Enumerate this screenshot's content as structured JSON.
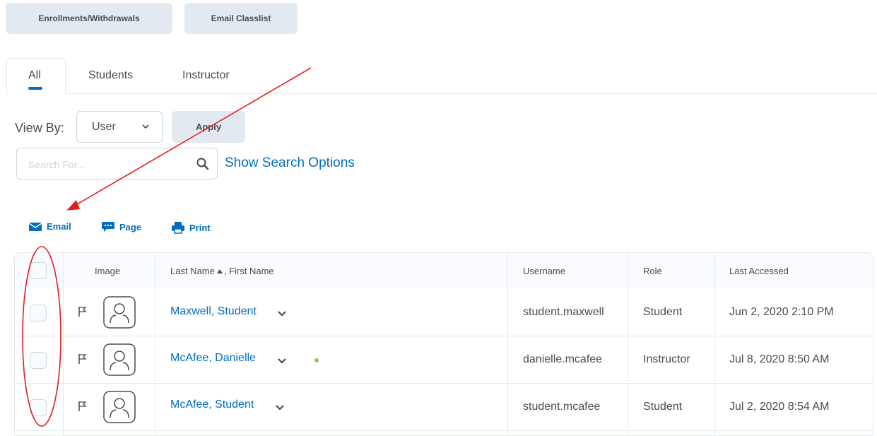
{
  "toolbar": {
    "enrollments_label": "Enrollments/Withdrawals",
    "email_classlist_label": "Email Classlist"
  },
  "tabs": [
    {
      "label": "All",
      "selected": true
    },
    {
      "label": "Students",
      "selected": false
    },
    {
      "label": "Instructor",
      "selected": false
    }
  ],
  "filter": {
    "view_by_label": "View By:",
    "view_by_value": "User",
    "apply_label": "Apply",
    "search_placeholder": "Search For...",
    "show_search_options": "Show Search Options"
  },
  "actions": {
    "email": "Email",
    "page": "Page",
    "print": "Print"
  },
  "table": {
    "headers": {
      "image": "Image",
      "last_name": "Last Name",
      "first_name": ", First Name",
      "username": "Username",
      "role": "Role",
      "last_accessed": "Last Accessed"
    },
    "rows": [
      {
        "name": "Maxwell, Student",
        "username": "student.maxwell",
        "role": "Student",
        "last_accessed": "Jun 2, 2020 2:10 PM",
        "online": false
      },
      {
        "name": "McAfee, Danielle",
        "username": "danielle.mcafee",
        "role": "Instructor",
        "last_accessed": "Jul 8, 2020 8:50 AM",
        "online": true
      },
      {
        "name": "McAfee, Student",
        "username": "student.mcafee",
        "role": "Student",
        "last_accessed": "Jul 2, 2020 8:54 AM",
        "online": false
      }
    ]
  },
  "colors": {
    "link": "#006fbf",
    "annotation": "#e0201f",
    "button_bg": "#e3e9f1"
  }
}
